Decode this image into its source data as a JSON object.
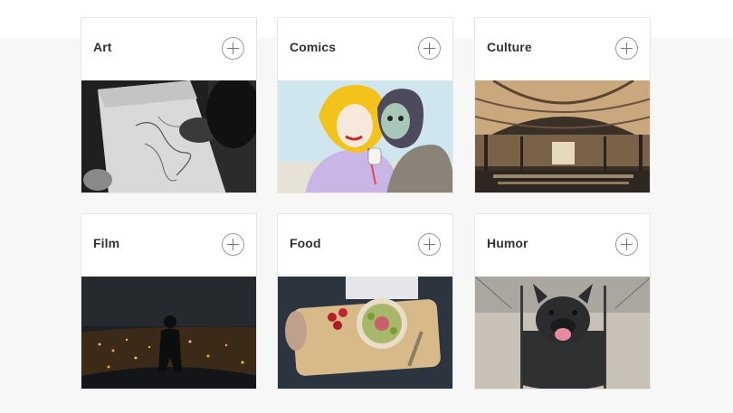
{
  "topics": [
    {
      "title": "Art",
      "image_icon": "sketching-hand-photo-icon",
      "action_icon": "plus-circle-icon"
    },
    {
      "title": "Comics",
      "image_icon": "comic-couple-illustration-icon",
      "action_icon": "plus-circle-icon"
    },
    {
      "title": "Culture",
      "image_icon": "library-hall-photo-icon",
      "action_icon": "plus-circle-icon"
    },
    {
      "title": "Film",
      "image_icon": "night-city-silhouette-photo-icon",
      "action_icon": "plus-circle-icon"
    },
    {
      "title": "Food",
      "image_icon": "smoothie-bowl-tray-photo-icon",
      "action_icon": "plus-circle-icon"
    },
    {
      "title": "Humor",
      "image_icon": "french-bulldog-swing-photo-icon",
      "action_icon": "plus-circle-icon"
    }
  ],
  "colors": {
    "page_band": "#f7f7f7",
    "card_border": "#e6e6e6",
    "title_text": "#333333",
    "button_stroke": "#9a9a9a"
  }
}
